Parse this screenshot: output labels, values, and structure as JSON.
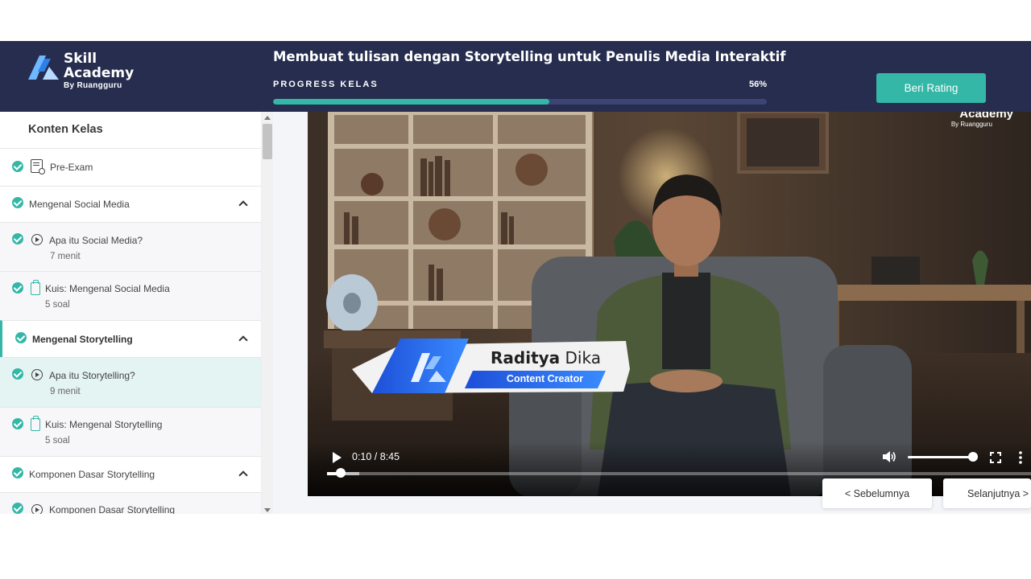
{
  "brand": {
    "line1": "Skill",
    "line2": "Academy",
    "sub": "By Ruangguru"
  },
  "course": {
    "title": "Membuat tulisan dengan Storytelling untuk Penulis Media Interaktif"
  },
  "progress": {
    "label": "PROGRESS KELAS",
    "percent_text": "56%",
    "fraction": 0.56
  },
  "rating_button": "Beri Rating",
  "sidebar": {
    "title": "Konten Kelas",
    "items": [
      {
        "type": "exam",
        "label": "Pre-Exam",
        "completed": true
      },
      {
        "type": "section",
        "label": "Mengenal Social Media",
        "completed": true,
        "expanded": true
      },
      {
        "type": "video",
        "label": "Apa itu Social Media?",
        "sub": "7 menit",
        "completed": true
      },
      {
        "type": "quiz",
        "label": "Kuis: Mengenal Social Media",
        "sub": "5 soal",
        "completed": true
      },
      {
        "type": "section",
        "label": "Mengenal Storytelling",
        "completed": true,
        "expanded": true,
        "active": true
      },
      {
        "type": "video",
        "label": "Apa itu Storytelling?",
        "sub": "9 menit",
        "completed": true,
        "current": true
      },
      {
        "type": "quiz",
        "label": "Kuis: Mengenal Storytelling",
        "sub": "5 soal",
        "completed": true
      },
      {
        "type": "section",
        "label": "Komponen Dasar Storytelling",
        "completed": true,
        "expanded": true
      },
      {
        "type": "video",
        "label": "Komponen Dasar Storytelling",
        "completed": true
      }
    ]
  },
  "video": {
    "watermark": {
      "text": "Academy",
      "sub": "By Ruangguru"
    },
    "lower_third": {
      "first_name": "Raditya",
      "last_name": " Dika",
      "role": "Content Creator"
    },
    "time": "0:10 / 8:45",
    "played_fraction": 0.019,
    "buffered_fraction": 0.046,
    "volume_fraction": 0.98
  },
  "navigation": {
    "prev": "<  Sebelumnya",
    "next": "Selanjutnya  >"
  },
  "colors": {
    "header": "#262d4f",
    "accent": "#34b7a7",
    "active_row": "#e3f4f2"
  },
  "icons": [
    "check-icon",
    "exam-icon",
    "play-circle-icon",
    "quiz-icon",
    "chevron-up-icon",
    "play-icon",
    "volume-icon",
    "fullscreen-icon",
    "more-vertical-icon"
  ]
}
